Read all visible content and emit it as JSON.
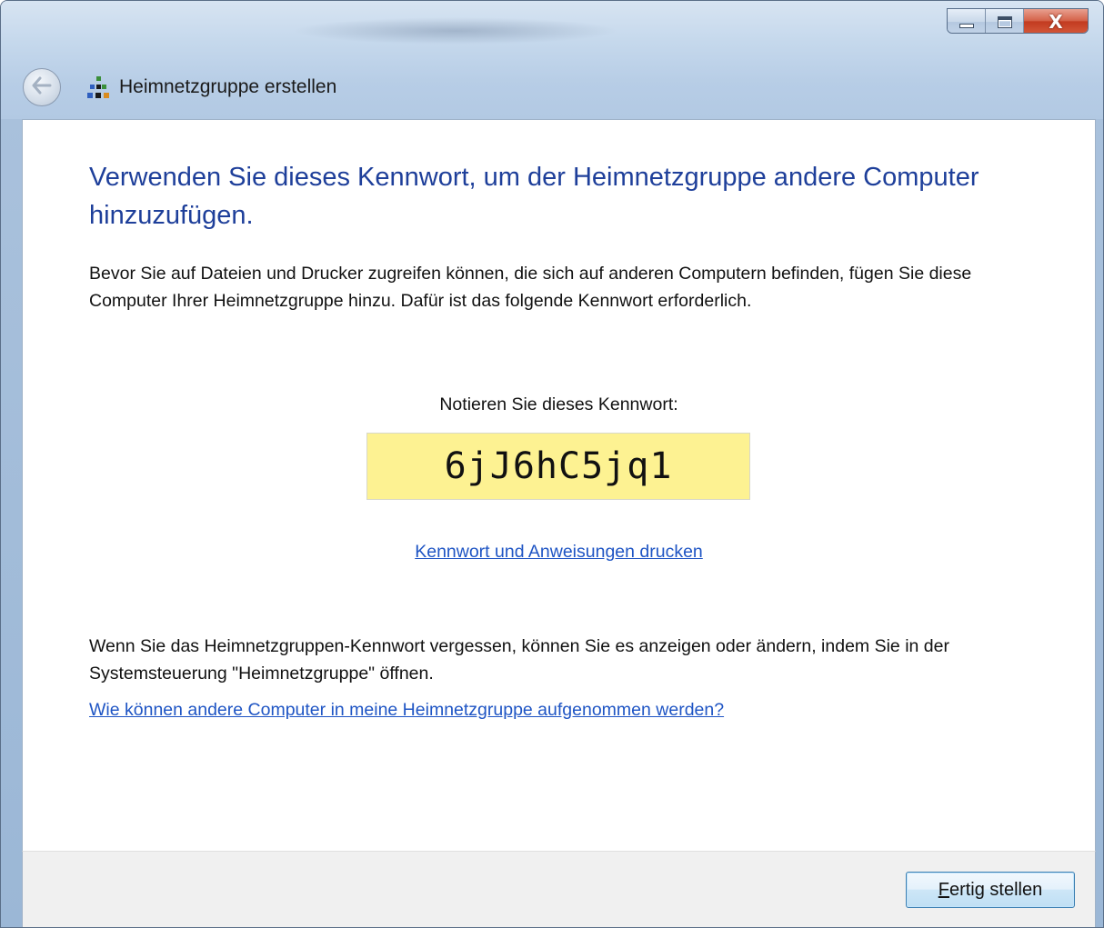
{
  "window": {
    "title": "Heimnetzgruppe erstellen",
    "controls": {
      "minimize_icon": "minimize-icon",
      "maximize_icon": "maximize-icon",
      "close_glyph": "X"
    }
  },
  "nav": {
    "back_arrow": "↩",
    "back_icon": "back-arrow-icon",
    "app_icon": "homegroup-icon"
  },
  "page": {
    "headline": "Verwenden Sie dieses Kennwort, um der Heimnetzgruppe andere Computer hinzuzufügen.",
    "intro": "Bevor Sie auf Dateien und Drucker zugreifen können, die sich auf anderen Computern befinden, fügen Sie diese Computer Ihrer Heimnetzgruppe hinzu. Dafür ist das folgende Kennwort erforderlich.",
    "password_label": "Notieren Sie dieses Kennwort:",
    "password": "6jJ6hC5jq1",
    "print_link": "Kennwort und Anweisungen drucken",
    "forgot_text": "Wenn Sie das Heimnetzgruppen-Kennwort vergessen, können Sie es anzeigen oder ändern, indem Sie in der Systemsteuerung \"Heimnetzgruppe\" öffnen.",
    "help_link": "Wie können andere Computer in meine Heimnetzgruppe aufgenommen werden?"
  },
  "footer": {
    "finish_button_accel": "F",
    "finish_button_rest": "ertig stellen"
  },
  "colors": {
    "heading": "#1e3f9a",
    "link": "#1f55c4",
    "password_bg": "#fdf292",
    "close_button": "#c23b20"
  }
}
